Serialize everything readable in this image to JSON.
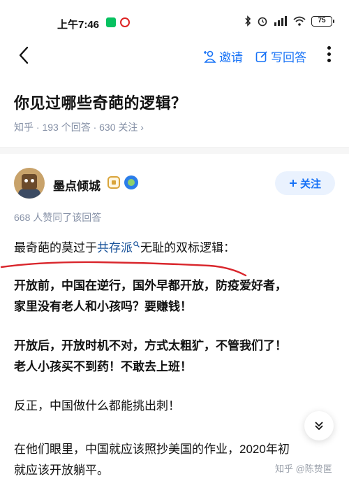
{
  "status_bar": {
    "time": "上午7:46",
    "battery": "75"
  },
  "nav": {
    "invite_label": "邀请",
    "write_label": "写回答"
  },
  "question": {
    "title": "你见过哪些奇葩的逻辑？",
    "meta": "知乎 · 193 个回答 · 630 关注 ›"
  },
  "author": {
    "name": "墨点倾城",
    "follow_label": "关注"
  },
  "answer": {
    "votes": "668 人赞同了该回答",
    "intro_before": "最奇葩的莫过于",
    "intro_link": "共存派",
    "intro_after": "无耻的双标逻辑：",
    "paragraphs": [
      [
        "开放前，中国在逆行，国外早都开放，防疫爱好者，",
        "家里没有老人和小孩吗？要赚钱！"
      ],
      [
        "开放后，开放时机不对，方式太粗犷，不管我们了！",
        "老人小孩买不到药！不敢去上班！"
      ],
      [
        "反正，中国做什么都能挑出刺！"
      ],
      [
        "在他们眼里，中国就应该照抄美国的作业，2020年初",
        "就应该开放躺平。"
      ]
    ]
  },
  "watermark": "知乎 @陈贽匿",
  "colors": {
    "accent": "#1772f6",
    "link": "#175199",
    "meta": "#8590a6",
    "underline": "#d9262c"
  },
  "icons": [
    "back-icon",
    "invite-person-icon",
    "write-icon",
    "more-icon",
    "bluetooth-icon",
    "alarm-icon",
    "signal-icon",
    "wifi-icon",
    "battery-icon",
    "plus-icon",
    "search-icon",
    "chevron-down-icon"
  ]
}
